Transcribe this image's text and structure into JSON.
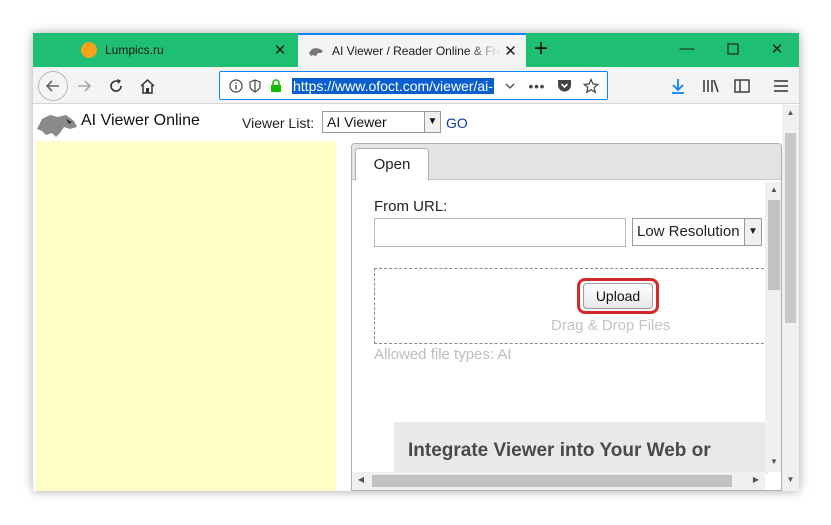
{
  "browser": {
    "tabs": [
      {
        "title": "Lumpics.ru",
        "active": false
      },
      {
        "title": "AI Viewer / Reader Online & Free",
        "active": true
      }
    ],
    "new_tab_icon": "plus-icon",
    "window_controls": [
      "minimize-icon",
      "maximize-icon",
      "close-icon"
    ],
    "url": "https://www.ofoct.com/viewer/ai-",
    "accent": "#1fbf73"
  },
  "page": {
    "app_title": "AI Viewer Online",
    "viewer_list_label": "Viewer List:",
    "viewer_selected": "AI Viewer",
    "go_label": "GO",
    "tabs": [
      {
        "label": "Open"
      }
    ],
    "from_url_label": "From URL:",
    "url_input_value": "",
    "resolution_selected": "Low Resolution",
    "upload_label": "Upload",
    "drag_drop_label": "Drag & Drop Files",
    "allowed_types": "Allowed file types: AI",
    "integrate_heading": "Integrate Viewer into Your Web or",
    "highlight_color": "#d42a2a",
    "left_panel_color": "#ffffc6"
  }
}
